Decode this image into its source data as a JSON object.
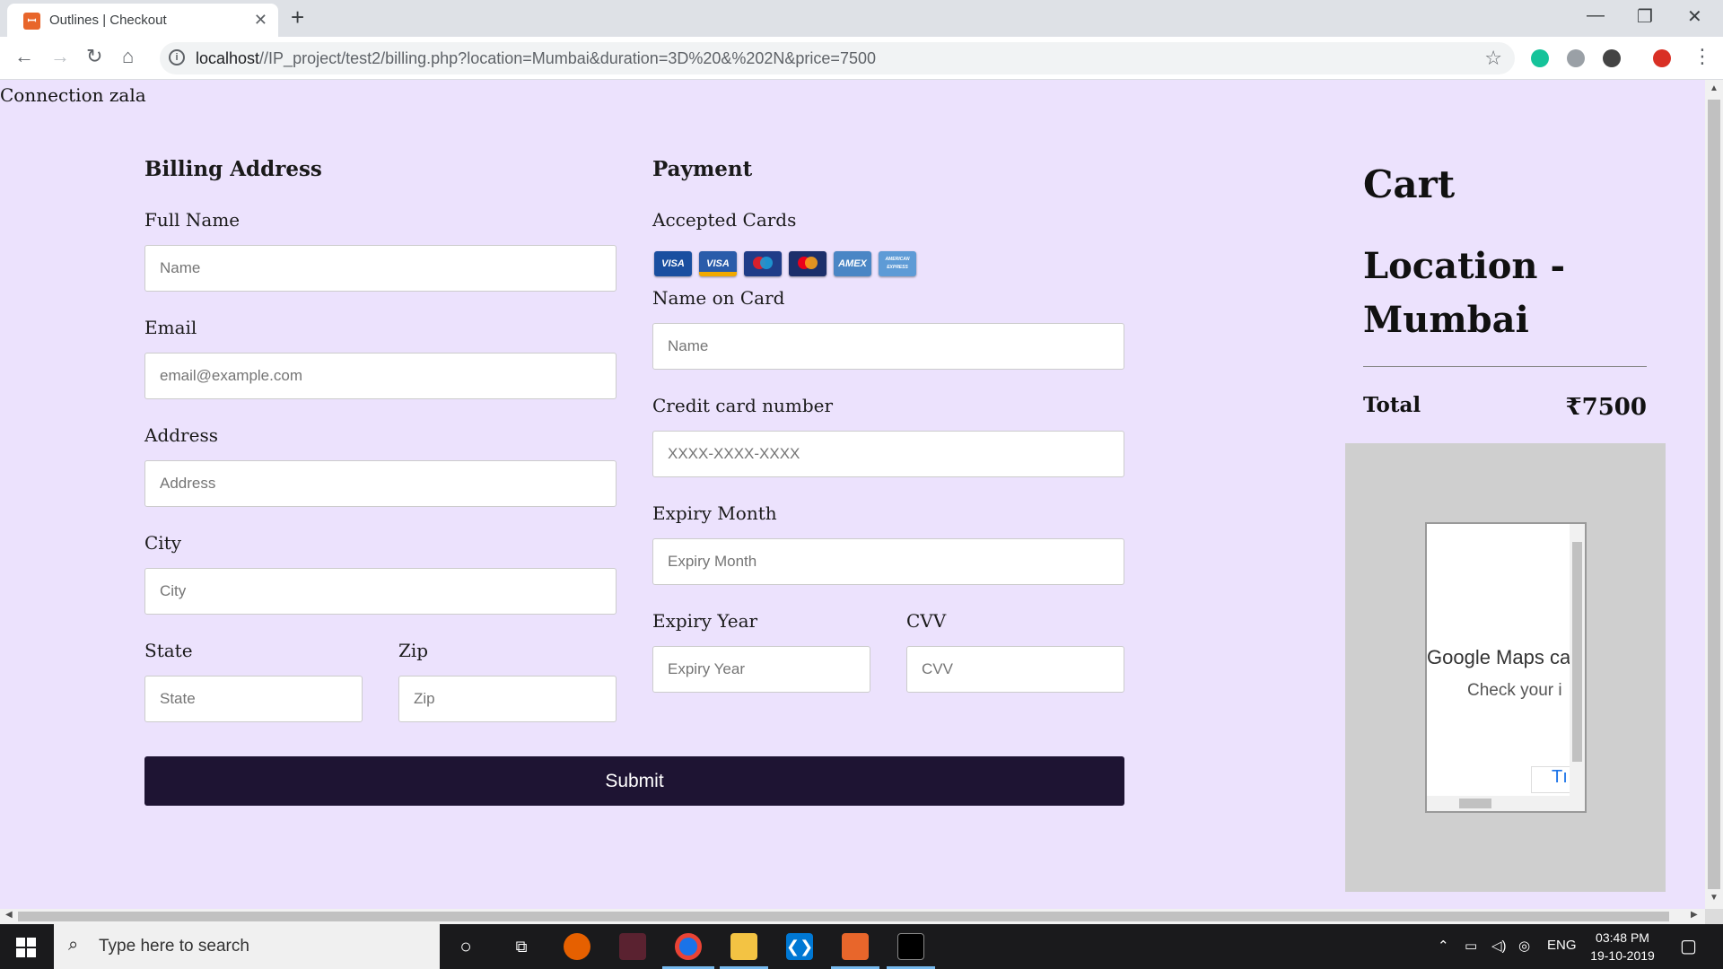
{
  "browser": {
    "tab_title": "Outlines | Checkout",
    "tab_favicon": "xampp-icon",
    "url_host": "localhost",
    "url_path": "//IP_project/test2/billing.php?location=Mumbai&duration=3D%20&%202N&price=7500"
  },
  "page": {
    "connection_text": "Connection zala"
  },
  "billing": {
    "heading": "Billing Address",
    "full_name_label": "Full Name",
    "full_name_placeholder": "Name",
    "email_label": "Email",
    "email_placeholder": "email@example.com",
    "address_label": "Address",
    "address_placeholder": "Address",
    "city_label": "City",
    "city_placeholder": "City",
    "state_label": "State",
    "state_placeholder": "State",
    "zip_label": "Zip",
    "zip_placeholder": "Zip"
  },
  "payment": {
    "heading": "Payment",
    "accepted_cards_label": "Accepted Cards",
    "cards": [
      {
        "name": "VISA",
        "icon": "visa-electron-icon",
        "color": "#1a4fa0"
      },
      {
        "name": "VISA",
        "icon": "visa-icon",
        "color": "#2a5caa"
      },
      {
        "name": "",
        "icon": "maestro-icon",
        "color": "#1f3c88"
      },
      {
        "name": "",
        "icon": "mastercard-icon",
        "color": "#1c2f6b"
      },
      {
        "name": "AMEX",
        "icon": "amex-icon",
        "color": "#4a86c5"
      },
      {
        "name": "AMERICAN EXPRESS",
        "icon": "american-express-icon",
        "color": "#5e9bd6"
      }
    ],
    "name_on_card_label": "Name on Card",
    "name_on_card_placeholder": "Name",
    "card_number_label": "Credit card number",
    "card_number_placeholder": "XXXX-XXXX-XXXX",
    "expiry_month_label": "Expiry Month",
    "expiry_month_placeholder": "Expiry Month",
    "expiry_year_label": "Expiry Year",
    "expiry_year_placeholder": "Expiry Year",
    "cvv_label": "CVV",
    "cvv_placeholder": "CVV"
  },
  "submit_label": "Submit",
  "cart": {
    "title": "Cart",
    "location_text": "Location - Mumbai",
    "total_label": "Total",
    "total_value": "₹7500",
    "map_error_title": "Google Maps ca",
    "map_error_sub": "Check your i",
    "map_button_text": "Tı"
  },
  "taskbar": {
    "search_placeholder": "Type here to search",
    "language": "ENG",
    "time": "03:48 PM",
    "date": "19-10-2019"
  },
  "colors": {
    "page_background": "#ece2fd",
    "submit_background": "#1e1433",
    "map_background": "#cfcfcf"
  }
}
